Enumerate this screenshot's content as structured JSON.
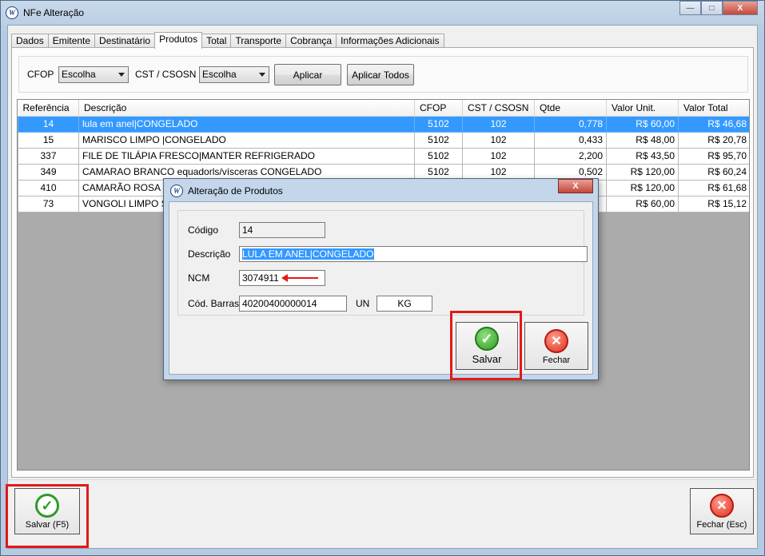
{
  "window": {
    "title": "NFe Alteração",
    "controls": {
      "minimize": "—",
      "maximize": "□",
      "close": "X"
    }
  },
  "tabs": [
    "Dados",
    "Emitente",
    "Destinatário",
    "Produtos",
    "Total",
    "Transporte",
    "Cobrança",
    "Informações Adicionais"
  ],
  "active_tab": "Produtos",
  "filters": {
    "cfop_label": "CFOP",
    "cfop_value": "Escolha",
    "cst_label": "CST / CSOSN",
    "cst_value": "Escolha",
    "apply_label": "Aplicar",
    "apply_all_label": "Aplicar Todos"
  },
  "grid": {
    "columns": [
      "Referência",
      "Descrição",
      "CFOP",
      "CST / CSOSN",
      "Qtde",
      "Valor Unit.",
      "Valor Total"
    ],
    "rows": [
      {
        "ref": "14",
        "desc": "lula em anel|CONGELADO",
        "cfop": "5102",
        "cst": "102",
        "qtde": "0,778",
        "unit": "R$ 60,00",
        "total": "R$ 46,68",
        "selected": true
      },
      {
        "ref": "15",
        "desc": "MARISCO LIMPO |CONGELADO",
        "cfop": "5102",
        "cst": "102",
        "qtde": "0,433",
        "unit": "R$ 48,00",
        "total": "R$ 20,78"
      },
      {
        "ref": "337",
        "desc": "FILE DE TILÁPIA FRESCO|MANTER REFRIGERADO",
        "cfop": "5102",
        "cst": "102",
        "qtde": "2,200",
        "unit": "R$ 43,50",
        "total": "R$ 95,70"
      },
      {
        "ref": "349",
        "desc": "CAMARAO BRANCO equadorls/vísceras CONGELADO",
        "cfop": "5102",
        "cst": "102",
        "qtde": "0,502",
        "unit": "R$ 120,00",
        "total": "R$ 60,24"
      },
      {
        "ref": "410",
        "desc": "CAMARÃO ROSA INT",
        "cfop": "",
        "cst": "",
        "qtde": "",
        "unit": "R$ 120,00",
        "total": "R$ 61,68"
      },
      {
        "ref": "73",
        "desc": "VONGOLI LIMPO S/ C",
        "cfop": "",
        "cst": "",
        "qtde": "",
        "unit": "R$ 60,00",
        "total": "R$ 15,12"
      }
    ]
  },
  "footer": {
    "save_label": "Salvar (F5)",
    "close_label": "Fechar (Esc)"
  },
  "dialog": {
    "title": "Alteração de Produtos",
    "close": "X",
    "codigo_label": "Código",
    "codigo_value": "14",
    "descricao_label": "Descrição",
    "descricao_value": "LULA EM ANEL|CONGELADO",
    "ncm_label": "NCM",
    "ncm_value": "3074911",
    "barras_label": "Cód. Barras",
    "barras_value": "40200400000014",
    "un_label": "UN",
    "un_value": "KG",
    "save_label": "Salvar",
    "close_label": "Fechar"
  },
  "icons": {
    "app": "app-logo-icon",
    "save": "checkmark-icon",
    "close": "x-circle-icon"
  },
  "colors": {
    "selection": "#3399ff",
    "highlight_frame": "#e01a1a",
    "ok_green": "#2e9a2a",
    "cancel_red": "#e02d1c"
  }
}
